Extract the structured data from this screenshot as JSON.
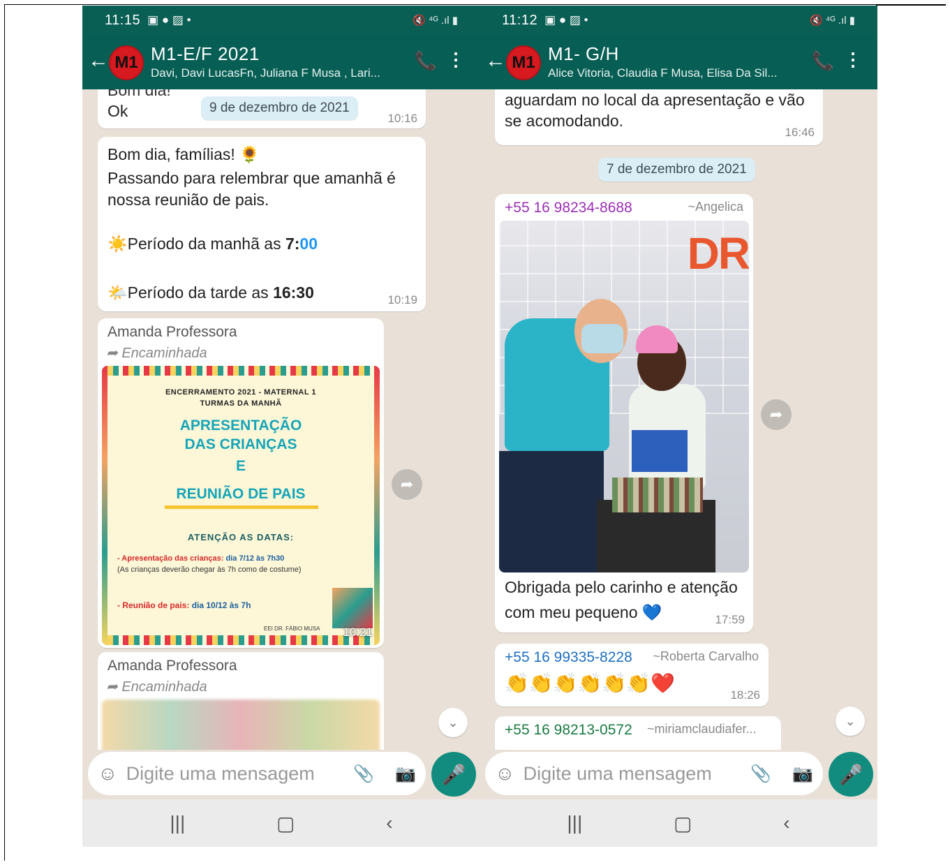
{
  "left": {
    "status": {
      "time": "11:15",
      "icons_left": "▣ ● ▨ •",
      "icons_right": "🔇 ⁴ᴳ .ıl ▮"
    },
    "header": {
      "back": "←",
      "avatar": "M1",
      "title": "M1-E/F  2021",
      "subtitle": "Davi, Davi LucasFn, Juliana F Musa , Lari..."
    },
    "messages": {
      "m0": {
        "text1": "Bom dia!",
        "text2": "Ok",
        "time": "10:16"
      },
      "date_chip": "9 de dezembro de 2021",
      "m1": {
        "line1": "Bom dia, famílias! 🌻",
        "line2": "Passando para relembrar que amanhã é nossa reunião de pais.",
        "morning_icon": "☀️",
        "morning_text": "Período da manhã as ",
        "morning_h": "7:",
        "morning_m": "00",
        "afternoon_icon": "🌤️",
        "afternoon_text": "Período da tarde as ",
        "afternoon_time": "16:30",
        "time": "10:19"
      },
      "m2": {
        "sender": "Amanda Professora",
        "forwarded": "Encaminhada",
        "poster": {
          "header_line1": "ENCERRAMENTO 2021 - MATERNAL 1",
          "header_line2": "TURMAS DA MANHÃ",
          "title_line1": "APRESENTAÇÃO",
          "title_line2": "DAS CRIANÇAS",
          "title_line3": "E",
          "title_line4": "REUNIÃO DE PAIS",
          "attention": "ATENÇÃO AS DATAS:",
          "item1_label": "- Apresentação das crianças:",
          "item1_value": " dia 7/12 às 7h30",
          "item1_note": "(As crianças deverão chegar às 7h como de costume)",
          "item2_label": "- Reunião de pais:",
          "item2_value": " dia 10/12 às 7h",
          "footer": "EEI DR. FÁBIO MUSA"
        },
        "time": "10:21"
      },
      "m3": {
        "sender": "Amanda Professora",
        "forwarded": "Encaminhada"
      }
    },
    "input": {
      "placeholder": "Digite uma mensagem"
    }
  },
  "right": {
    "status": {
      "time": "11:12",
      "icons_left": "▣ ● ▨ •",
      "icons_right": "🔇 ⁴ᴳ .ıl ▮"
    },
    "header": {
      "back": "←",
      "avatar": "M1",
      "title": "M1- G/H",
      "subtitle": "Alice Vitoria, Claudia F Musa, Elisa Da Sil..."
    },
    "messages": {
      "m0": {
        "text1": "aguardam no local da apresentação e vão",
        "text2": "se acomodando.",
        "time": "16:46"
      },
      "date_chip": "7 de dezembro de 2021",
      "m1": {
        "phone": "+55 16 98234-8688",
        "alias": "~Angelica",
        "caption1": "Obrigada pelo carinho e atenção",
        "caption2": "com meu pequeno 💙",
        "photo_sign": "DR",
        "time": "17:59"
      },
      "m2": {
        "phone": "+55 16 99335-8228",
        "alias": "~Roberta Carvalho",
        "text": "👏👏👏👏👏👏❤️",
        "time": "18:26"
      },
      "m3": {
        "phone": "+55 16 98213-0572",
        "alias": "~miriamclaudiafer..."
      }
    },
    "input": {
      "placeholder": "Digite uma mensagem"
    }
  },
  "nav": {
    "recent": "|||",
    "home": "▢",
    "back": "‹"
  }
}
